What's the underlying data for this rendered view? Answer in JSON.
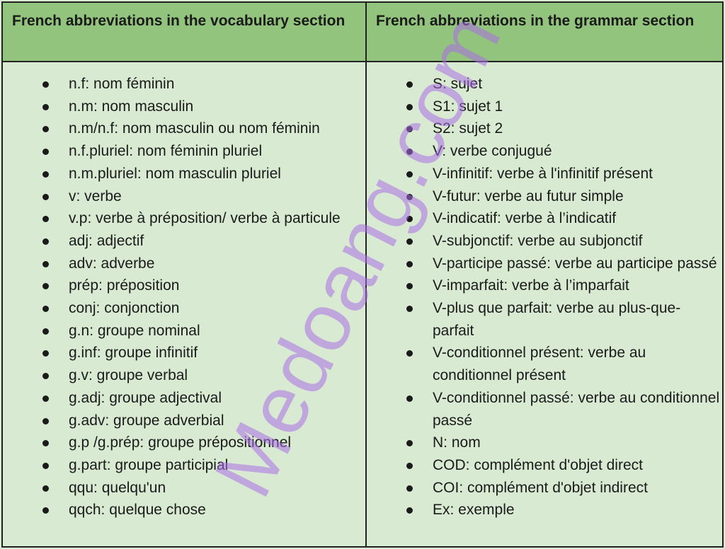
{
  "columns": [
    {
      "header": "French abbreviations in the vocabulary section",
      "items": [
        "n.f: nom féminin",
        "n.m: nom masculin",
        "n.m/n.f: nom masculin ou nom féminin",
        "n.f.pluriel: nom féminin pluriel",
        "n.m.pluriel: nom masculin pluriel",
        "v: verbe",
        "v.p: verbe à préposition/ verbe à particule",
        "adj: adjectif",
        "adv: adverbe",
        "prép: préposition",
        "conj: conjonction",
        "g.n: groupe nominal",
        "g.inf: groupe infinitif",
        "g.v: groupe verbal",
        "g.adj: groupe adjectival",
        "g.adv: groupe adverbial",
        "g.p /g.prép: groupe prépositionnel",
        "g.part: groupe participial",
        "qqu: quelqu'un",
        "qqch: quelque chose"
      ]
    },
    {
      "header": "French abbreviations in the grammar section",
      "items": [
        "S: sujet",
        "S1: sujet 1",
        "S2: sujet 2",
        "V: verbe conjugué",
        "V-infinitif: verbe à l'infinitif présent",
        "V-futur: verbe au futur simple",
        "V-indicatif: verbe à l’indicatif",
        "V-subjonctif: verbe au subjonctif",
        "V-participe passé: verbe au participe passé",
        "V-imparfait: verbe à l’imparfait",
        "V-plus que parfait: verbe au plus-que-parfait",
        "V-conditionnel présent: verbe au conditionnel présent",
        "V-conditionnel passé: verbe au conditionnel passé",
        "N: nom",
        "COD: complément d'objet direct",
        "COI: complément d'objet indirect",
        "Ex: exemple"
      ]
    }
  ],
  "watermark": "Medoang.com",
  "colors": {
    "header_bg": "#93c47d",
    "body_bg": "#d9ead3",
    "watermark": "#aa6ee6"
  }
}
